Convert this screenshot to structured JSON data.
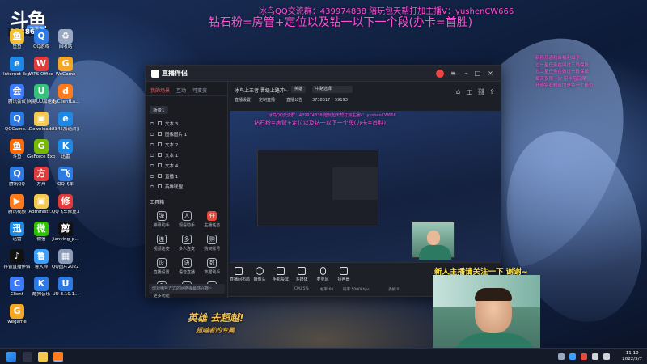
{
  "stream_overlay": {
    "qq_group": "冰鸟QQ交流群：439974838  陪玩包天帮打加主播V：yushenCW666",
    "title_line": "钻石粉=房管+定位以及钻一以下一个段(办卡=首胜)",
    "side_notes": [
      "新粉开通粉丝福利如下：",
      "过一星任务在叫过三局保段",
      "过二星任务在做过一段保段",
      "每天仅限一次 陪伴陪玩保",
      "开通钻石粉丝团是钻一个段位"
    ],
    "webcam_caption": "新人主播请关注一下 谢谢~"
  },
  "room_logo": {
    "brand": "斗鱼",
    "room_number": "3738617",
    "tag": "直播中"
  },
  "desktop_icons": [
    {
      "label": "鱼鱼",
      "color": "#f3c130",
      "glyph": "鱼"
    },
    {
      "label": "QQ游戏",
      "color": "#2c7be5",
      "glyph": "Q"
    },
    {
      "label": "回收站",
      "color": "#9aa8bf",
      "glyph": "♻"
    },
    {
      "label": "Internet Explorer",
      "color": "#1e88e5",
      "glyph": "e"
    },
    {
      "label": "WPS Office",
      "color": "#e23b3b",
      "glyph": "W"
    },
    {
      "label": "WeGame",
      "color": "#f5a623",
      "glyph": "G"
    },
    {
      "label": "腾讯会议",
      "color": "#3d7bfd",
      "glyph": "会"
    },
    {
      "label": "网易UU加速器",
      "color": "#37c27a",
      "glyph": "U"
    },
    {
      "label": "dyClientLa...",
      "color": "#ff7a1a",
      "glyph": "d"
    },
    {
      "label": "QQGame...",
      "color": "#2c7be5",
      "glyph": "Q"
    },
    {
      "label": "Downloads",
      "color": "#f2c94c",
      "glyph": "▣"
    },
    {
      "label": "2345加速浏览器",
      "color": "#1e88e5",
      "glyph": "e"
    },
    {
      "label": "斗鱼",
      "color": "#ff6a00",
      "glyph": "鱼"
    },
    {
      "label": "GeForce Experience",
      "color": "#76b900",
      "glyph": "G"
    },
    {
      "label": "迅雷",
      "color": "#1e88e5",
      "glyph": "K"
    },
    {
      "label": "腾讯QQ",
      "color": "#2c7be5",
      "glyph": "Q"
    },
    {
      "label": "方舟",
      "color": "#e23b3b",
      "glyph": "方"
    },
    {
      "label": "QQ飞车",
      "color": "#2c7be5",
      "glyph": "飞"
    },
    {
      "label": "腾讯视频",
      "color": "#ff7a1a",
      "glyph": "▶"
    },
    {
      "label": "Administr...",
      "color": "#f2c94c",
      "glyph": "▣"
    },
    {
      "label": "QQ飞车修复工具",
      "color": "#e23b3b",
      "glyph": "修"
    },
    {
      "label": "迅雷",
      "color": "#1e88e5",
      "glyph": "迅"
    },
    {
      "label": "微信",
      "color": "#2dc100",
      "glyph": "微"
    },
    {
      "label": "Jianying_p...",
      "color": "#111111",
      "glyph": "剪"
    },
    {
      "label": "抖音直播伴侣",
      "color": "#111111",
      "glyph": "♪"
    },
    {
      "label": "鲁大师",
      "color": "#3aa0ff",
      "glyph": "鲁"
    },
    {
      "label": "QQ图片20220507...",
      "color": "#8a9bb7",
      "glyph": "▦"
    },
    {
      "label": "Client",
      "color": "#3d7bfd",
      "glyph": "C"
    },
    {
      "label": "酷狗音乐",
      "color": "#2c7be5",
      "glyph": "K"
    },
    {
      "label": "UU-3.10.1...",
      "color": "#2c7be5",
      "glyph": "U"
    },
    {
      "label": "wegame",
      "color": "#f5a623",
      "glyph": "G"
    }
  ],
  "app": {
    "title": "直播伴侣",
    "left_tabs": [
      "我的场景",
      "互动",
      "可变资"
    ],
    "scene_label": "场景1",
    "sources": [
      "文本 3",
      "图像图片 1",
      "文本 2",
      "文本 1",
      "文本 4",
      "直播 1",
      "英雄联盟"
    ],
    "toolbox_title": "工具箱",
    "tools": [
      {
        "label": "弹幕助手",
        "glyph": "弹",
        "hot": false
      },
      {
        "label": "观看助手",
        "glyph": "人",
        "hot": false
      },
      {
        "label": "主播任务",
        "glyph": "任",
        "hot": true
      },
      {
        "label": "视频连麦",
        "glyph": "连",
        "hot": false
      },
      {
        "label": "多人连麦",
        "glyph": "多",
        "hot": false
      },
      {
        "label": "购买账号",
        "glyph": "购",
        "hot": false
      },
      {
        "label": "直播设置",
        "glyph": "设",
        "hot": false
      },
      {
        "label": "语音直播",
        "glyph": "语",
        "hot": false
      },
      {
        "label": "数据助手",
        "glyph": "数",
        "hot": false
      },
      {
        "label": "更多功能",
        "glyph": "多",
        "hot": false
      },
      {
        "label": "",
        "glyph": "＋",
        "hot": false
      },
      {
        "label": "",
        "glyph": "◎",
        "hot": false
      }
    ],
    "bottom_notice": "你对哪些方式的网络弹幕感兴趣~",
    "stream_title": "冰鸟上王者 晋级上路冲~",
    "category": "英雄",
    "category_value": "中路选择",
    "meta_room": "3738617",
    "meta_online": "59193",
    "meta_tags": [
      "直播设置",
      "定制直播",
      "直播公告"
    ],
    "bottom_buttons": [
      "直播间布局",
      "摄像头",
      "手机投屏",
      "多媒体",
      "麦克风",
      "扬声器"
    ],
    "stats": [
      "CPU:5%",
      "帧率:60",
      "码率:5000kbps",
      "丢帧:0"
    ]
  },
  "taskbar": {
    "time": "11:19",
    "date": "2022/5/7"
  },
  "banner": {
    "line1": "英雄 去超越!",
    "line2": "超越者的专属"
  }
}
